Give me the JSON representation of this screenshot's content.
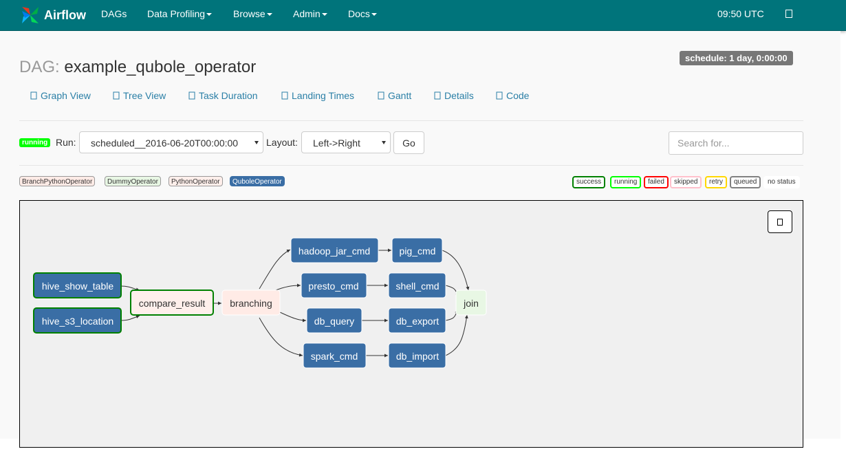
{
  "navbar": {
    "brand": "Airflow",
    "items": [
      {
        "label": "DAGs",
        "dropdown": false
      },
      {
        "label": "Data Profiling",
        "dropdown": true
      },
      {
        "label": "Browse",
        "dropdown": true
      },
      {
        "label": "Admin",
        "dropdown": true
      },
      {
        "label": "Docs",
        "dropdown": true
      }
    ],
    "time": "09:50 UTC",
    "user_icon": "user-icon",
    "color": "#00747b"
  },
  "dag": {
    "label": "DAG:",
    "name": "example_qubole_operator",
    "schedule": "schedule: 1 day, 0:00:00"
  },
  "tabs": [
    {
      "label": "Graph View",
      "icon": "graph-icon"
    },
    {
      "label": "Tree View",
      "icon": "tree-icon"
    },
    {
      "label": "Task Duration",
      "icon": "duration-icon"
    },
    {
      "label": "Landing Times",
      "icon": "landing-icon"
    },
    {
      "label": "Gantt",
      "icon": "gantt-icon"
    },
    {
      "label": "Details",
      "icon": "details-icon"
    },
    {
      "label": "Code",
      "icon": "code-icon"
    }
  ],
  "controls": {
    "state_badge": "running",
    "run_label": "Run:",
    "run_value": "scheduled__2016-06-20T00:00:00",
    "layout_label": "Layout:",
    "layout_value": "Left->Right",
    "go_label": "Go",
    "search_placeholder": "Search for..."
  },
  "operators": [
    {
      "label": "BranchPythonOperator",
      "color": "#ffebe6"
    },
    {
      "label": "DummyOperator",
      "color": "#e8f7e4"
    },
    {
      "label": "PythonOperator",
      "color": "#ffefeb"
    },
    {
      "label": "QuboleOperator",
      "color": "#3a6ea5"
    }
  ],
  "legend": [
    {
      "label": "success",
      "color": "#008000"
    },
    {
      "label": "running",
      "color": "#00ff00"
    },
    {
      "label": "failed",
      "color": "#ff0000"
    },
    {
      "label": "skipped",
      "color": "#ffc0cb"
    },
    {
      "label": "retry",
      "color": "#ffd700"
    },
    {
      "label": "queued",
      "color": "#808080"
    },
    {
      "label": "no status",
      "color": "#ffffff"
    }
  ],
  "graph": {
    "refresh_icon": "refresh-icon",
    "nodes": {
      "hive_show_table": "hive_show_table",
      "hive_s3_location": "hive_s3_location",
      "compare_result": "compare_result",
      "branching": "branching",
      "hadoop_jar_cmd": "hadoop_jar_cmd",
      "presto_cmd": "presto_cmd",
      "db_query": "db_query",
      "spark_cmd": "spark_cmd",
      "pig_cmd": "pig_cmd",
      "shell_cmd": "shell_cmd",
      "db_export": "db_export",
      "db_import": "db_import",
      "join": "join"
    }
  }
}
